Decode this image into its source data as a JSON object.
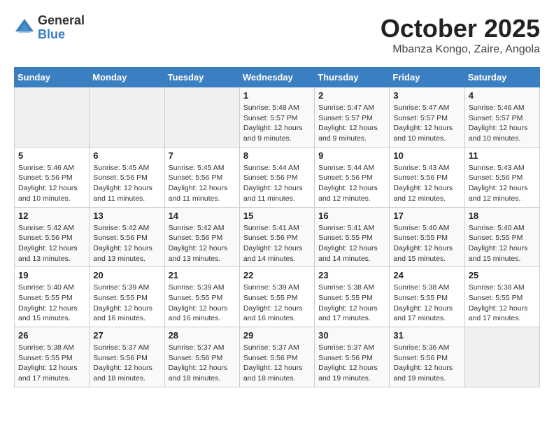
{
  "header": {
    "logo_general": "General",
    "logo_blue": "Blue",
    "month": "October 2025",
    "location": "Mbanza Kongo, Zaire, Angola"
  },
  "days_of_week": [
    "Sunday",
    "Monday",
    "Tuesday",
    "Wednesday",
    "Thursday",
    "Friday",
    "Saturday"
  ],
  "weeks": [
    [
      {
        "day": "",
        "info": ""
      },
      {
        "day": "",
        "info": ""
      },
      {
        "day": "",
        "info": ""
      },
      {
        "day": "1",
        "info": "Sunrise: 5:48 AM\nSunset: 5:57 PM\nDaylight: 12 hours and 9 minutes."
      },
      {
        "day": "2",
        "info": "Sunrise: 5:47 AM\nSunset: 5:57 PM\nDaylight: 12 hours and 9 minutes."
      },
      {
        "day": "3",
        "info": "Sunrise: 5:47 AM\nSunset: 5:57 PM\nDaylight: 12 hours and 10 minutes."
      },
      {
        "day": "4",
        "info": "Sunrise: 5:46 AM\nSunset: 5:57 PM\nDaylight: 12 hours and 10 minutes."
      }
    ],
    [
      {
        "day": "5",
        "info": "Sunrise: 5:46 AM\nSunset: 5:56 PM\nDaylight: 12 hours and 10 minutes."
      },
      {
        "day": "6",
        "info": "Sunrise: 5:45 AM\nSunset: 5:56 PM\nDaylight: 12 hours and 11 minutes."
      },
      {
        "day": "7",
        "info": "Sunrise: 5:45 AM\nSunset: 5:56 PM\nDaylight: 12 hours and 11 minutes."
      },
      {
        "day": "8",
        "info": "Sunrise: 5:44 AM\nSunset: 5:56 PM\nDaylight: 12 hours and 11 minutes."
      },
      {
        "day": "9",
        "info": "Sunrise: 5:44 AM\nSunset: 5:56 PM\nDaylight: 12 hours and 12 minutes."
      },
      {
        "day": "10",
        "info": "Sunrise: 5:43 AM\nSunset: 5:56 PM\nDaylight: 12 hours and 12 minutes."
      },
      {
        "day": "11",
        "info": "Sunrise: 5:43 AM\nSunset: 5:56 PM\nDaylight: 12 hours and 12 minutes."
      }
    ],
    [
      {
        "day": "12",
        "info": "Sunrise: 5:42 AM\nSunset: 5:56 PM\nDaylight: 12 hours and 13 minutes."
      },
      {
        "day": "13",
        "info": "Sunrise: 5:42 AM\nSunset: 5:56 PM\nDaylight: 12 hours and 13 minutes."
      },
      {
        "day": "14",
        "info": "Sunrise: 5:42 AM\nSunset: 5:56 PM\nDaylight: 12 hours and 13 minutes."
      },
      {
        "day": "15",
        "info": "Sunrise: 5:41 AM\nSunset: 5:56 PM\nDaylight: 12 hours and 14 minutes."
      },
      {
        "day": "16",
        "info": "Sunrise: 5:41 AM\nSunset: 5:55 PM\nDaylight: 12 hours and 14 minutes."
      },
      {
        "day": "17",
        "info": "Sunrise: 5:40 AM\nSunset: 5:55 PM\nDaylight: 12 hours and 15 minutes."
      },
      {
        "day": "18",
        "info": "Sunrise: 5:40 AM\nSunset: 5:55 PM\nDaylight: 12 hours and 15 minutes."
      }
    ],
    [
      {
        "day": "19",
        "info": "Sunrise: 5:40 AM\nSunset: 5:55 PM\nDaylight: 12 hours and 15 minutes."
      },
      {
        "day": "20",
        "info": "Sunrise: 5:39 AM\nSunset: 5:55 PM\nDaylight: 12 hours and 16 minutes."
      },
      {
        "day": "21",
        "info": "Sunrise: 5:39 AM\nSunset: 5:55 PM\nDaylight: 12 hours and 16 minutes."
      },
      {
        "day": "22",
        "info": "Sunrise: 5:39 AM\nSunset: 5:55 PM\nDaylight: 12 hours and 16 minutes."
      },
      {
        "day": "23",
        "info": "Sunrise: 5:38 AM\nSunset: 5:55 PM\nDaylight: 12 hours and 17 minutes."
      },
      {
        "day": "24",
        "info": "Sunrise: 5:38 AM\nSunset: 5:55 PM\nDaylight: 12 hours and 17 minutes."
      },
      {
        "day": "25",
        "info": "Sunrise: 5:38 AM\nSunset: 5:55 PM\nDaylight: 12 hours and 17 minutes."
      }
    ],
    [
      {
        "day": "26",
        "info": "Sunrise: 5:38 AM\nSunset: 5:55 PM\nDaylight: 12 hours and 17 minutes."
      },
      {
        "day": "27",
        "info": "Sunrise: 5:37 AM\nSunset: 5:56 PM\nDaylight: 12 hours and 18 minutes."
      },
      {
        "day": "28",
        "info": "Sunrise: 5:37 AM\nSunset: 5:56 PM\nDaylight: 12 hours and 18 minutes."
      },
      {
        "day": "29",
        "info": "Sunrise: 5:37 AM\nSunset: 5:56 PM\nDaylight: 12 hours and 18 minutes."
      },
      {
        "day": "30",
        "info": "Sunrise: 5:37 AM\nSunset: 5:56 PM\nDaylight: 12 hours and 19 minutes."
      },
      {
        "day": "31",
        "info": "Sunrise: 5:36 AM\nSunset: 5:56 PM\nDaylight: 12 hours and 19 minutes."
      },
      {
        "day": "",
        "info": ""
      }
    ]
  ]
}
